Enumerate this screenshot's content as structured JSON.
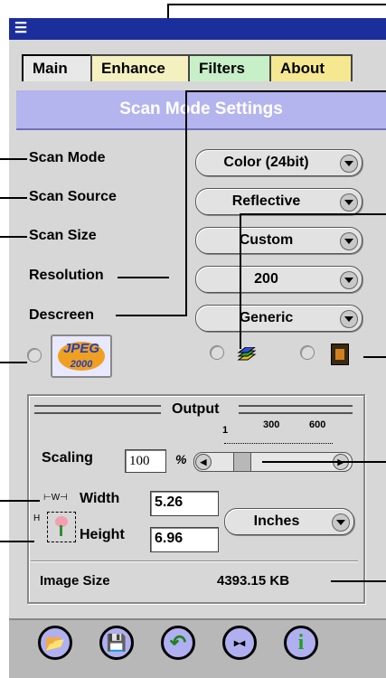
{
  "window": {
    "sys_icon": "window-menu-icon"
  },
  "tabs": [
    {
      "label": "Main",
      "active": true
    },
    {
      "label": "Enhance",
      "color": "#f5f0c0"
    },
    {
      "label": "Filters",
      "color": "#c8f0c8"
    },
    {
      "label": "About",
      "color": "#f5e890"
    }
  ],
  "header": {
    "title": "Scan Mode Settings"
  },
  "settings": [
    {
      "label": "Scan Mode",
      "value": "Color (24bit)"
    },
    {
      "label": "Scan Source",
      "value": "Reflective"
    },
    {
      "label": "Scan Size",
      "value": "Custom"
    },
    {
      "label": "Resolution",
      "value": "200"
    },
    {
      "label": "Descreen",
      "value": "Generic"
    }
  ],
  "format_options": [
    {
      "icon": "jpeg2000-icon",
      "text": "JPEG 2000"
    },
    {
      "icon": "layers-icon"
    },
    {
      "icon": "film-icon"
    }
  ],
  "output": {
    "title": "Output",
    "scaling_label": "Scaling",
    "scaling_value": "100",
    "scaling_unit": "%",
    "ticks": [
      "1",
      "300",
      "600"
    ],
    "width_label": "Width",
    "width_value": "5.26",
    "height_label": "Height",
    "height_value": "6.96",
    "unit_value": "Inches",
    "image_size_label": "Image Size",
    "image_size_value": "4393.15 KB",
    "scale_marks": {
      "w": "⊢W⊣",
      "h": "H"
    }
  },
  "toolbar": [
    {
      "icon": "open-folder-icon",
      "glyph": "📂"
    },
    {
      "icon": "save-disk-icon",
      "glyph": "💾"
    },
    {
      "icon": "undo-arrow-icon",
      "glyph": "↶"
    },
    {
      "icon": "preview-icon",
      "glyph": "▸◂"
    },
    {
      "icon": "info-icon",
      "glyph": "i"
    }
  ],
  "colors": {
    "title_bar": "#1c2e9c",
    "header": "#b4b4ee",
    "toolbar_button": "#b0b0f0"
  }
}
